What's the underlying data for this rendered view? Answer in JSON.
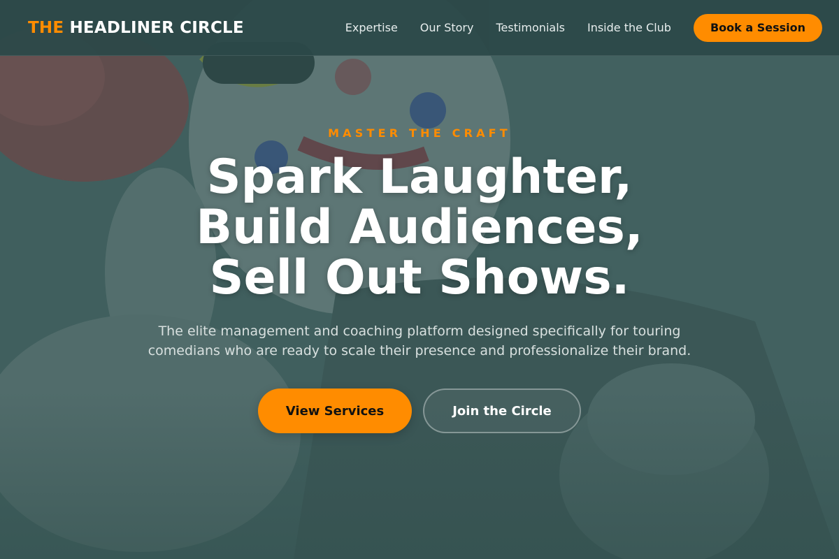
{
  "header": {
    "logo_accent": "THE",
    "logo_main": "HEADLINER CIRCLE",
    "nav": [
      {
        "label": "Expertise"
      },
      {
        "label": "Our Story"
      },
      {
        "label": "Testimonials"
      },
      {
        "label": "Inside the Club"
      }
    ],
    "cta_label": "Book a Session"
  },
  "hero": {
    "eyebrow": "MASTER THE CRAFT",
    "headline_lines": [
      "Spark Laughter,",
      "Build Audiences,",
      "Sell Out Shows."
    ],
    "subtext": "The elite management and coaching platform designed specifically for touring comedians who are ready to scale their presence and professionalize their brand.",
    "primary_button": "View Services",
    "secondary_button": "Join the Circle",
    "background_image": "clown-with-sunglasses-photo"
  },
  "colors": {
    "accent": "#ff8c00",
    "header_bg": "#2c4848",
    "overlay": "#2f4f4f",
    "text_light": "#ffffff",
    "text_muted": "#d8e0df"
  }
}
